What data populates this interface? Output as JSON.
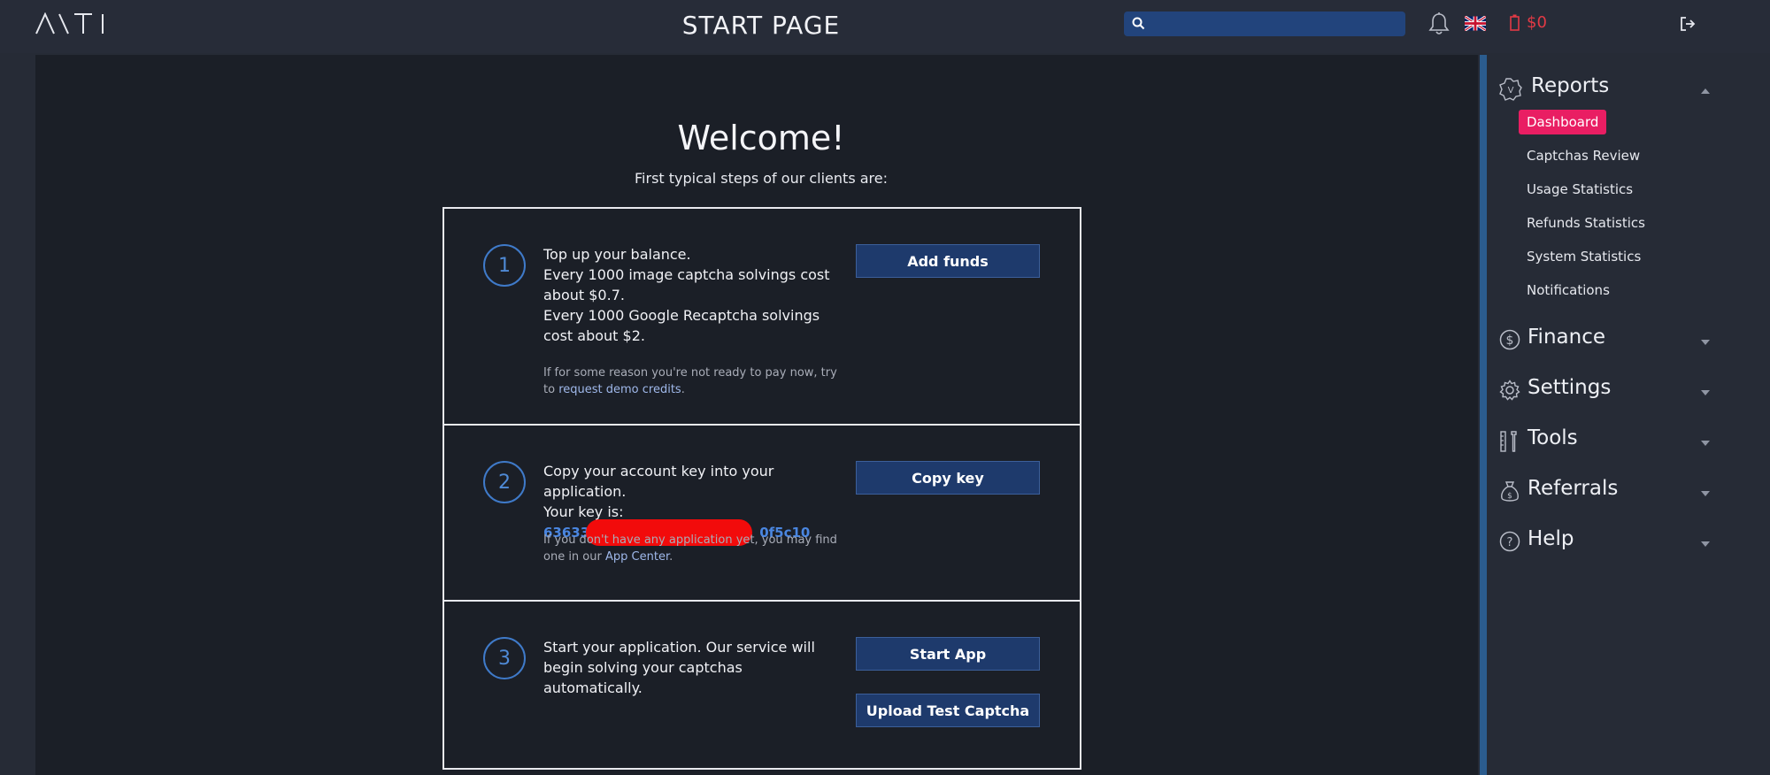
{
  "header": {
    "logo": "Λ\\TI",
    "page_title": "START PAGE",
    "search_placeholder": "",
    "balance": "$0"
  },
  "welcome": {
    "title": "Welcome!",
    "subtitle": "First typical steps of our clients are:"
  },
  "steps": [
    {
      "number": "1",
      "lines": [
        "Top up your balance.",
        "Every 1000 image captcha solvings cost about $0.7.",
        "Every 1000 Google Recaptcha solvings cost about $2."
      ],
      "note_prefix": "If for some reason you're not ready to pay now, try to",
      "note_link": "request demo credits",
      "note_suffix": ".",
      "button": "Add funds"
    },
    {
      "number": "2",
      "lines": [
        "Copy your account key into your application.",
        "Your key is:"
      ],
      "key_start": "63633",
      "key_end": "0f5c10",
      "note_prefix": "If you don't have any application yet, you may find one in our",
      "note_link": "App Center",
      "note_suffix": ".",
      "button": "Copy key"
    },
    {
      "number": "3",
      "lines": [
        "Start your application. Our service will begin solving your captchas automatically."
      ],
      "button": "Start App",
      "button2": "Upload Test Captcha"
    }
  ],
  "sidebar": {
    "reports": {
      "label": "Reports",
      "items": [
        {
          "label": "Dashboard",
          "active": true
        },
        {
          "label": "Captchas Review"
        },
        {
          "label": "Usage Statistics"
        },
        {
          "label": "Refunds Statistics"
        },
        {
          "label": "System Statistics"
        },
        {
          "label": "Notifications"
        }
      ]
    },
    "finance": "Finance",
    "settings": "Settings",
    "tools": "Tools",
    "referrals": "Referrals",
    "help": "Help"
  },
  "colors": {
    "accent_active": "#e91e63",
    "button_bg": "#1e3a6c",
    "balance_red": "#e23a45",
    "link_blue": "#4a86e0"
  }
}
